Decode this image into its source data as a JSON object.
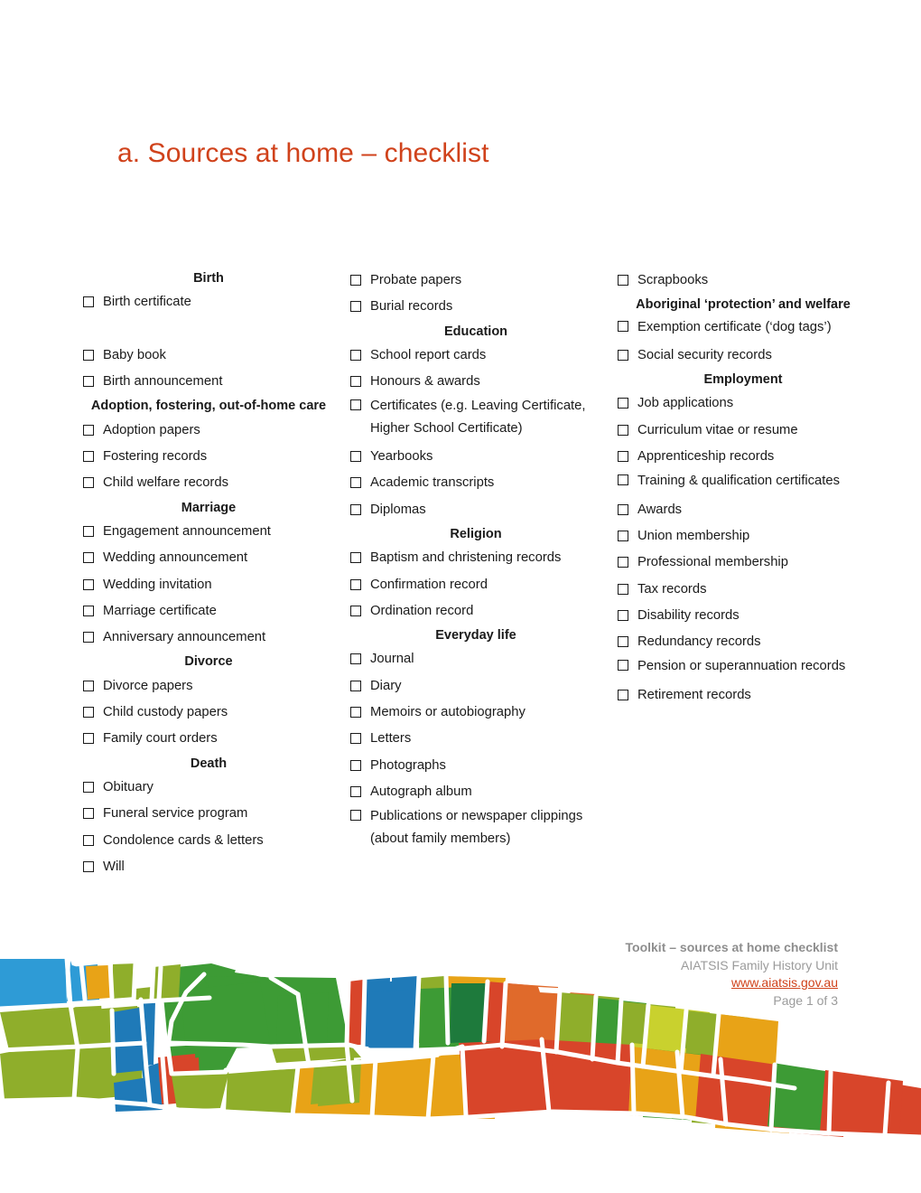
{
  "document": {
    "title": "a. Sources at home – checklist",
    "title_color": "#D0421B",
    "page_background": "#ffffff",
    "text_color": "#1a1a1a",
    "checkbox_glyph": "empty-square"
  },
  "checklist": {
    "columns": [
      {
        "id": "column-1",
        "blocks": [
          {
            "type": "heading",
            "text": "Birth"
          },
          {
            "type": "item",
            "text": "Birth certificate"
          },
          {
            "type": "spacer"
          },
          {
            "type": "item",
            "text": "Baby book"
          },
          {
            "type": "item",
            "text": "Birth announcement"
          },
          {
            "type": "heading",
            "text": "Adoption, fostering, out-of-home care"
          },
          {
            "type": "item",
            "text": "Adoption papers"
          },
          {
            "type": "item",
            "text": "Fostering records"
          },
          {
            "type": "item",
            "text": "Child welfare records"
          },
          {
            "type": "heading",
            "text": "Marriage"
          },
          {
            "type": "item",
            "text": "Engagement announcement"
          },
          {
            "type": "item",
            "text": "Wedding announcement"
          },
          {
            "type": "item",
            "text": "Wedding invitation"
          },
          {
            "type": "item",
            "text": "Marriage certificate"
          },
          {
            "type": "item",
            "text": "Anniversary announcement"
          },
          {
            "type": "heading",
            "text": "Divorce"
          },
          {
            "type": "item",
            "text": "Divorce papers"
          },
          {
            "type": "item",
            "text": "Child custody papers"
          },
          {
            "type": "item",
            "text": "Family court orders"
          },
          {
            "type": "heading",
            "text": "Death"
          },
          {
            "type": "item",
            "text": "Obituary"
          },
          {
            "type": "item",
            "text": "Funeral service program"
          },
          {
            "type": "item",
            "text": "Condolence cards & letters"
          },
          {
            "type": "item",
            "text": "Will"
          }
        ]
      },
      {
        "id": "column-2",
        "blocks": [
          {
            "type": "item",
            "text": "Probate papers"
          },
          {
            "type": "item",
            "text": "Burial records"
          },
          {
            "type": "heading",
            "text": "Education"
          },
          {
            "type": "item",
            "text": "School report cards"
          },
          {
            "type": "item",
            "text": "Honours & awards"
          },
          {
            "type": "item",
            "text": "Certificates (e.g. Leaving Certificate, Higher School Certificate)",
            "wrapped": true
          },
          {
            "type": "item",
            "text": "Yearbooks"
          },
          {
            "type": "item",
            "text": "Academic transcripts"
          },
          {
            "type": "item",
            "text": "Diplomas"
          },
          {
            "type": "heading",
            "text": "Religion"
          },
          {
            "type": "item",
            "text": "Baptism and christening records"
          },
          {
            "type": "item",
            "text": "Confirmation record"
          },
          {
            "type": "item",
            "text": "Ordination record"
          },
          {
            "type": "heading",
            "text": "Everyday life"
          },
          {
            "type": "item",
            "text": "Journal"
          },
          {
            "type": "item",
            "text": "Diary"
          },
          {
            "type": "item",
            "text": "Memoirs or autobiography"
          },
          {
            "type": "item",
            "text": "Letters"
          },
          {
            "type": "item",
            "text": "Photographs"
          },
          {
            "type": "item",
            "text": "Autograph album"
          },
          {
            "type": "item",
            "text": "Publications or newspaper clippings (about family members)",
            "wrapped": true
          }
        ]
      },
      {
        "id": "column-3",
        "blocks": [
          {
            "type": "item",
            "text": "Scrapbooks"
          },
          {
            "type": "heading",
            "text": "Aboriginal ‘protection’ and welfare"
          },
          {
            "type": "item",
            "text": "Exemption certificate (‘dog tags’)",
            "wrapped": true
          },
          {
            "type": "item",
            "text": "Social security records"
          },
          {
            "type": "heading",
            "text": "Employment"
          },
          {
            "type": "item",
            "text": "Job applications"
          },
          {
            "type": "item",
            "text": "Curriculum vitae or resume"
          },
          {
            "type": "item",
            "text": "Apprenticeship records"
          },
          {
            "type": "item",
            "text": "Training & qualification certificates",
            "wrapped": true
          },
          {
            "type": "item",
            "text": "Awards"
          },
          {
            "type": "item",
            "text": "Union membership"
          },
          {
            "type": "item",
            "text": "Professional membership"
          },
          {
            "type": "item",
            "text": "Tax records"
          },
          {
            "type": "item",
            "text": "Disability records"
          },
          {
            "type": "item",
            "text": "Redundancy records"
          },
          {
            "type": "item",
            "text": "Pension or superannuation records",
            "wrapped": true
          },
          {
            "type": "item",
            "text": "Retirement records"
          }
        ]
      }
    ]
  },
  "footer": {
    "line1": "Toolkit – sources at home checklist",
    "line2": "AIATSIS Family History Unit",
    "url": "www.aiatsis.gov.au",
    "page": "Page 1 of 3",
    "text_color": "#9b9b9b",
    "url_color": "#D0421B"
  },
  "decoration": {
    "name": "mosaic-band",
    "colors": [
      "#2E9BD6",
      "#8FAE2B",
      "#3D9B35",
      "#E8A317",
      "#D8452A",
      "#1F7AB8",
      "#1E7A3C",
      "#C9D12E",
      "#E06A2B"
    ]
  }
}
